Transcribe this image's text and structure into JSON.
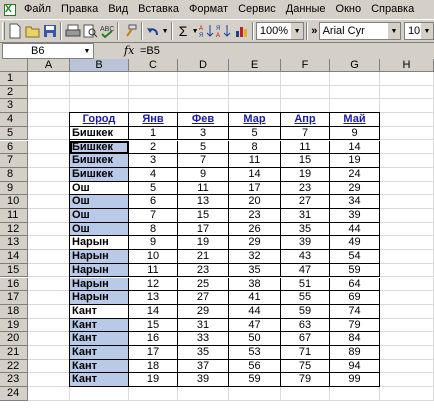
{
  "menu": [
    "Файл",
    "Правка",
    "Вид",
    "Вставка",
    "Формат",
    "Сервис",
    "Данные",
    "Окно",
    "Справка"
  ],
  "toolbar": {
    "zoom": "100%",
    "font": "Arial Cyr",
    "size": "10",
    "sigma": "Σ",
    "more": "»"
  },
  "formula": {
    "namebox": "B6",
    "fx": "fx",
    "value": "=B5"
  },
  "columns": [
    "A",
    "B",
    "C",
    "D",
    "E",
    "F",
    "G",
    "H"
  ],
  "rows": [
    "1",
    "2",
    "3",
    "4",
    "5",
    "6",
    "7",
    "8",
    "9",
    "10",
    "11",
    "12",
    "13",
    "14",
    "15",
    "16",
    "17",
    "18",
    "19",
    "20",
    "21",
    "22",
    "23",
    "24"
  ],
  "table": {
    "headers": [
      "Город",
      "Янв",
      "Фев",
      "Мар",
      "Апр",
      "Май"
    ],
    "rows": [
      {
        "city": "Бишкек",
        "vals": [
          "1",
          "3",
          "5",
          "7",
          "9"
        ],
        "hl": false
      },
      {
        "city": "Бишкек",
        "vals": [
          "2",
          "5",
          "8",
          "11",
          "14"
        ],
        "hl": true
      },
      {
        "city": "Бишкек",
        "vals": [
          "3",
          "7",
          "11",
          "15",
          "19"
        ],
        "hl": true
      },
      {
        "city": "Бишкек",
        "vals": [
          "4",
          "9",
          "14",
          "19",
          "24"
        ],
        "hl": true
      },
      {
        "city": "Ош",
        "vals": [
          "5",
          "11",
          "17",
          "23",
          "29"
        ],
        "hl": false
      },
      {
        "city": "Ош",
        "vals": [
          "6",
          "13",
          "20",
          "27",
          "34"
        ],
        "hl": true
      },
      {
        "city": "Ош",
        "vals": [
          "7",
          "15",
          "23",
          "31",
          "39"
        ],
        "hl": true
      },
      {
        "city": "Ош",
        "vals": [
          "8",
          "17",
          "26",
          "35",
          "44"
        ],
        "hl": true
      },
      {
        "city": "Нарын",
        "vals": [
          "9",
          "19",
          "29",
          "39",
          "49"
        ],
        "hl": false
      },
      {
        "city": "Нарын",
        "vals": [
          "10",
          "21",
          "32",
          "43",
          "54"
        ],
        "hl": true
      },
      {
        "city": "Нарын",
        "vals": [
          "11",
          "23",
          "35",
          "47",
          "59"
        ],
        "hl": true
      },
      {
        "city": "Нарын",
        "vals": [
          "12",
          "25",
          "38",
          "51",
          "64"
        ],
        "hl": true
      },
      {
        "city": "Нарын",
        "vals": [
          "13",
          "27",
          "41",
          "55",
          "69"
        ],
        "hl": true
      },
      {
        "city": "Кант",
        "vals": [
          "14",
          "29",
          "44",
          "59",
          "74"
        ],
        "hl": false
      },
      {
        "city": "Кант",
        "vals": [
          "15",
          "31",
          "47",
          "63",
          "79"
        ],
        "hl": true
      },
      {
        "city": "Кант",
        "vals": [
          "16",
          "33",
          "50",
          "67",
          "84"
        ],
        "hl": true
      },
      {
        "city": "Кант",
        "vals": [
          "17",
          "35",
          "53",
          "71",
          "89"
        ],
        "hl": true
      },
      {
        "city": "Кант",
        "vals": [
          "18",
          "37",
          "56",
          "75",
          "94"
        ],
        "hl": true
      },
      {
        "city": "Кант",
        "vals": [
          "19",
          "39",
          "59",
          "79",
          "99"
        ],
        "hl": true
      }
    ]
  }
}
